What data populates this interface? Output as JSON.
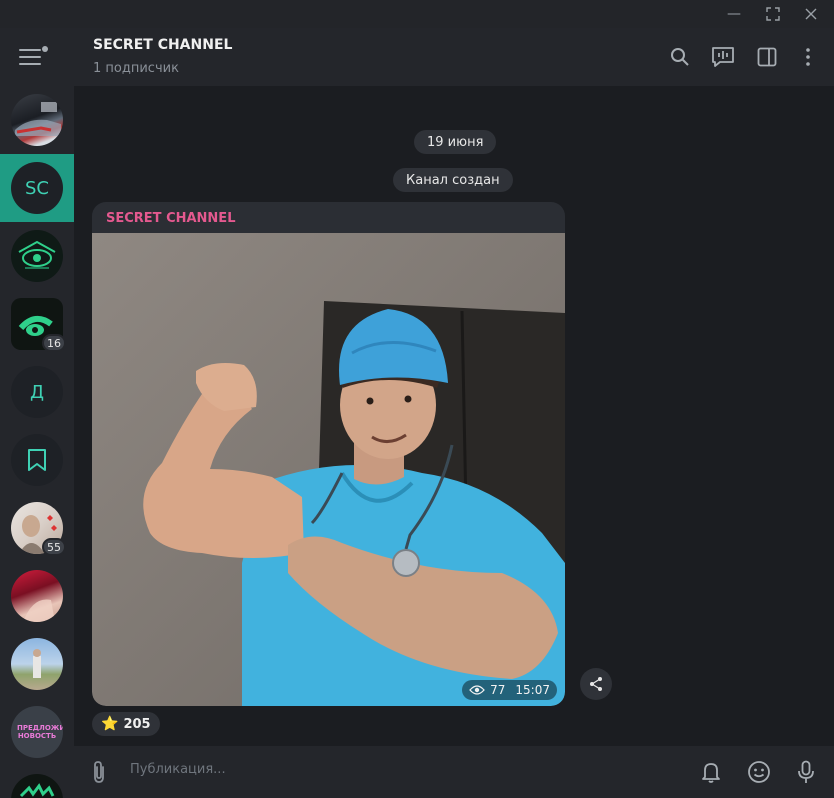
{
  "window": {
    "controls": {
      "minimize": "—",
      "maximize": "⛶",
      "close": "✕"
    }
  },
  "sidebar": {
    "items": [
      {
        "name": "chat-car",
        "badge": ""
      },
      {
        "name": "chat-secret-channel",
        "initials": "SC",
        "badge": ""
      },
      {
        "name": "chat-green-eye-circle",
        "badge": ""
      },
      {
        "name": "chat-green-eye-square",
        "badge": "16"
      },
      {
        "name": "chat-d",
        "initials": "Д",
        "badge": ""
      },
      {
        "name": "chat-saved",
        "badge": ""
      },
      {
        "name": "chat-person-hearts",
        "badge": "55"
      },
      {
        "name": "chat-red",
        "badge": ""
      },
      {
        "name": "chat-person-outdoor",
        "badge": ""
      },
      {
        "name": "chat-propose-news",
        "text": "ПРЕДЛОЖИТЬ НОВОСТЬ",
        "badge": ""
      },
      {
        "name": "chat-green-partial",
        "badge": ""
      }
    ]
  },
  "header": {
    "title": "SECRET CHANNEL",
    "subtitle": "1 подписчик"
  },
  "chat": {
    "date": "19 июня",
    "service_message": "Канал создан",
    "message": {
      "author": "SECRET CHANNEL",
      "views": "77",
      "time": "15:07"
    },
    "reaction": {
      "emoji": "⭐",
      "count": "205"
    }
  },
  "composer": {
    "placeholder": "Публикация..."
  },
  "colors": {
    "accent": "#1f9c84",
    "author": "#e4598f",
    "background": "#1b1d21",
    "panel": "#24262b"
  }
}
